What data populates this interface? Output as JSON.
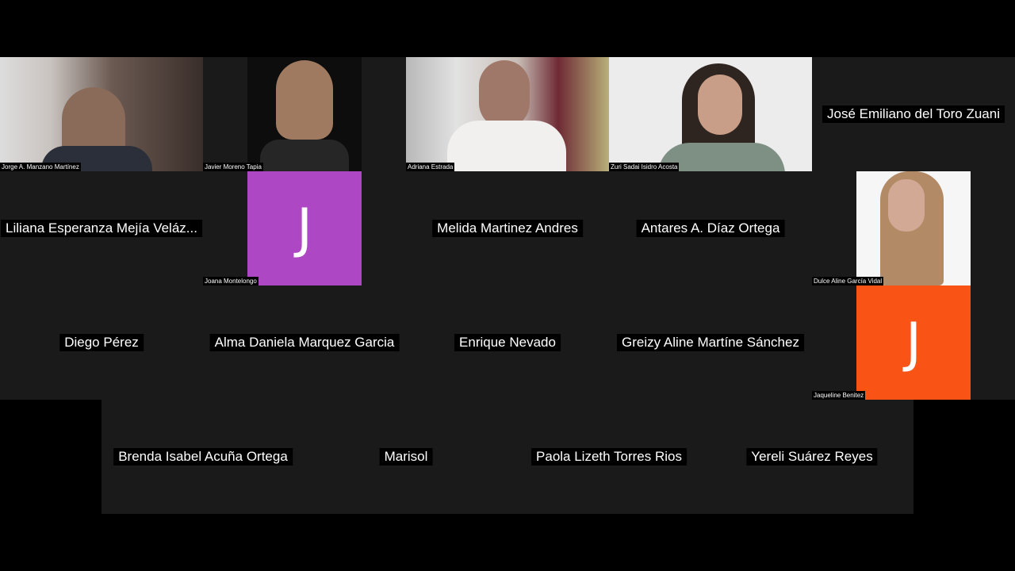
{
  "colors": {
    "tile_bg": "#1a1a1a",
    "avatar_purple": "#ad47c4",
    "avatar_orange": "#fa5316"
  },
  "participants": [
    {
      "name": "Jorge A. Manzano Martínez",
      "kind": "video"
    },
    {
      "name": "Javier Moreno Tapia",
      "kind": "video"
    },
    {
      "name": "Adriana Estrada",
      "kind": "video"
    },
    {
      "name": "Zuri Sadai Isidro Acosta",
      "kind": "video"
    },
    {
      "name": "José Emiliano del Toro Zuani",
      "kind": "name"
    },
    {
      "name": "Liliana Esperanza Mejía Veláz...",
      "kind": "name"
    },
    {
      "name": "Joana Montelongo",
      "kind": "avatar",
      "initial": "J"
    },
    {
      "name": "Melida Martinez Andres",
      "kind": "name"
    },
    {
      "name": "Antares A. Díaz Ortega",
      "kind": "name"
    },
    {
      "name": "Dulce Aline García Vidal",
      "kind": "video"
    },
    {
      "name": "Diego Pérez",
      "kind": "name"
    },
    {
      "name": "Alma Daniela Marquez Garcia",
      "kind": "name"
    },
    {
      "name": "Enrique Nevado",
      "kind": "name"
    },
    {
      "name": "Greizy Aline Martíne Sánchez",
      "kind": "name"
    },
    {
      "name": "Jaqueline Benitez",
      "kind": "avatar",
      "initial": "J"
    },
    {
      "name": "Brenda Isabel Acuña  Ortega",
      "kind": "name"
    },
    {
      "name": "Marisol",
      "kind": "name"
    },
    {
      "name": "Paola Lizeth Torres Rios",
      "kind": "name"
    },
    {
      "name": "Yereli Suárez Reyes",
      "kind": "name"
    }
  ]
}
